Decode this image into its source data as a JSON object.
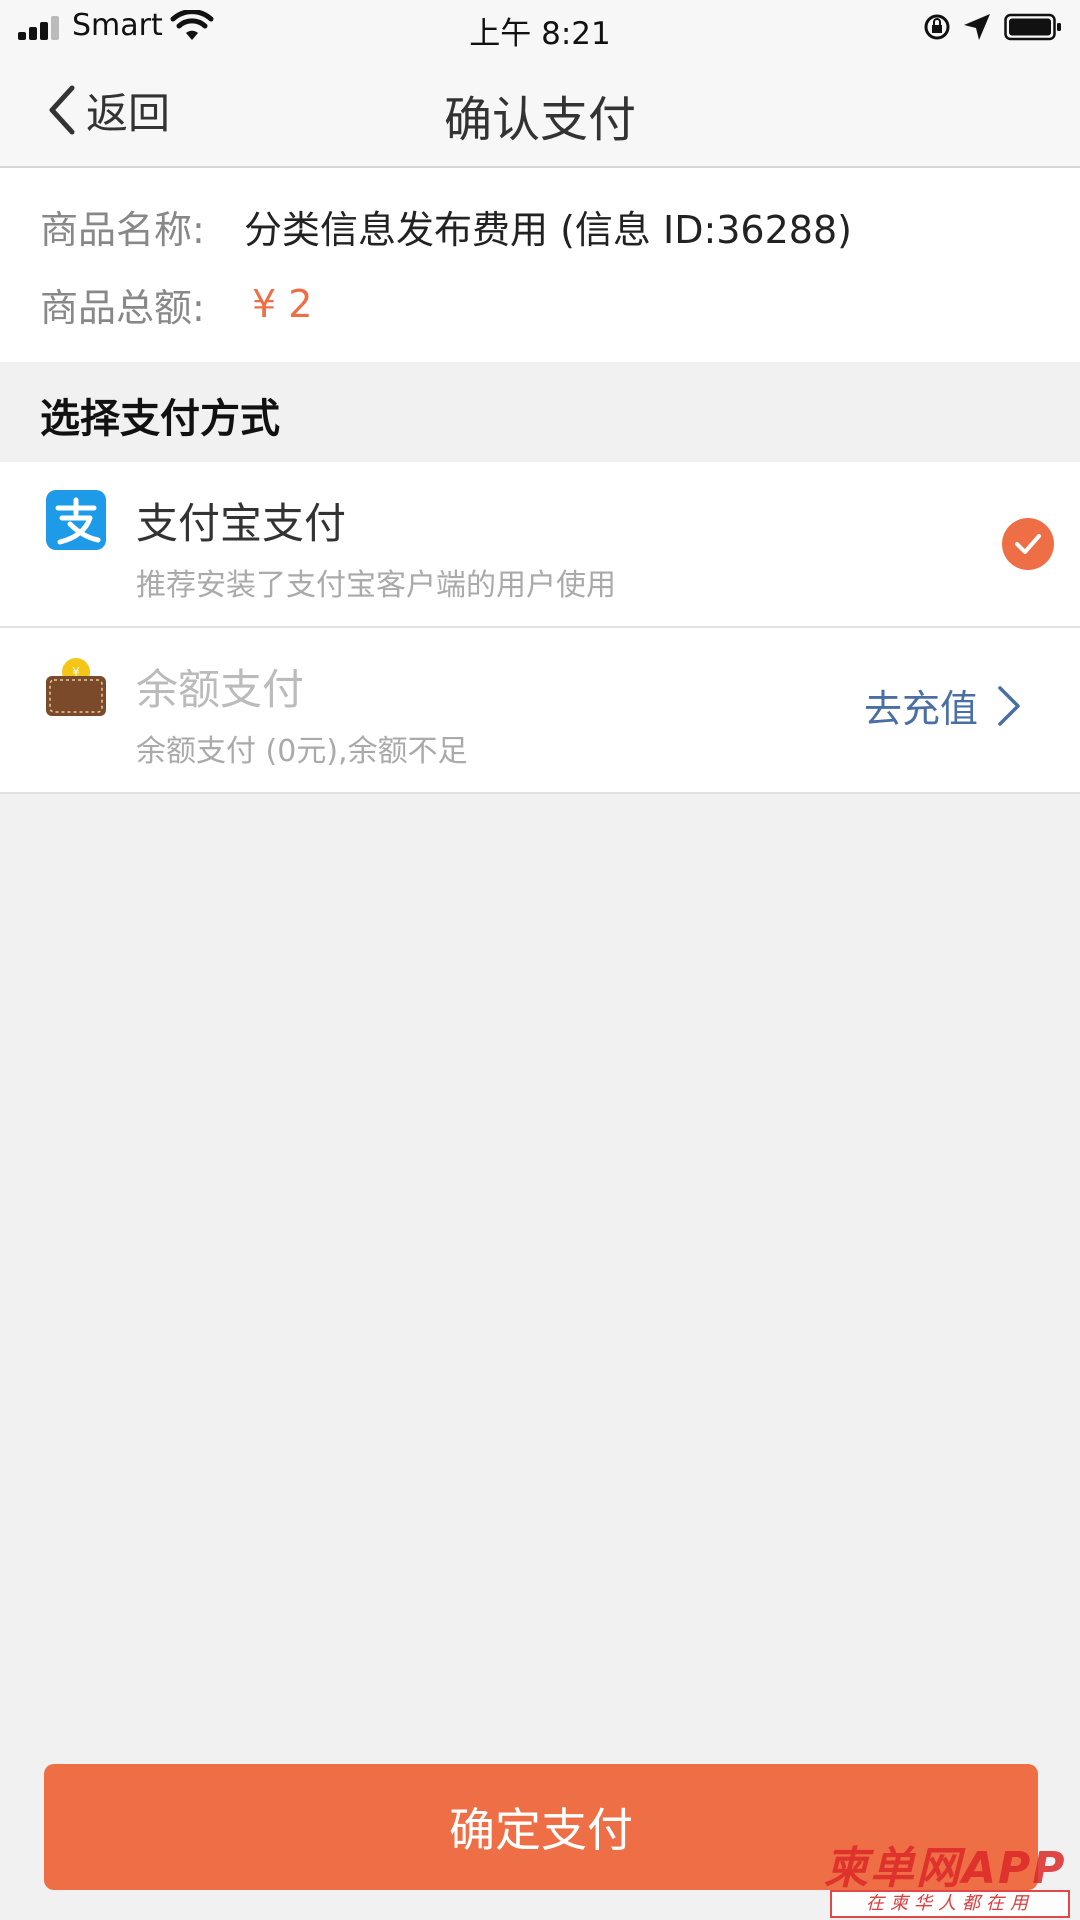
{
  "status_bar": {
    "carrier": "Smart",
    "time": "上午 8:21",
    "icons": [
      "signal-icon",
      "wifi-icon",
      "orientation-lock-icon",
      "location-icon",
      "battery-icon"
    ]
  },
  "nav": {
    "back_label": "返回",
    "title": "确认支付"
  },
  "product": {
    "name_label": "商品名称:",
    "name_value": "分类信息发布费用 (信息 ID:36288)",
    "amount_label": "商品总额:",
    "amount_value": "¥ 2"
  },
  "payment": {
    "section_title": "选择支付方式",
    "options": [
      {
        "title": "支付宝支付",
        "subtitle": "推荐安装了支付宝客户端的用户使用",
        "icon": "alipay-icon",
        "selected": true
      },
      {
        "title": "余额支付",
        "subtitle": "余额支付 (0元),余额不足",
        "icon": "wallet-icon",
        "action_label": "去充值"
      }
    ]
  },
  "confirm_label": "确定支付",
  "watermark": {
    "top": "柬单网APP",
    "bottom": "在柬华人都在用"
  },
  "colors": {
    "accent": "#ee6f45",
    "link": "#4a6fa5",
    "alipay_blue": "#1e9be8"
  }
}
